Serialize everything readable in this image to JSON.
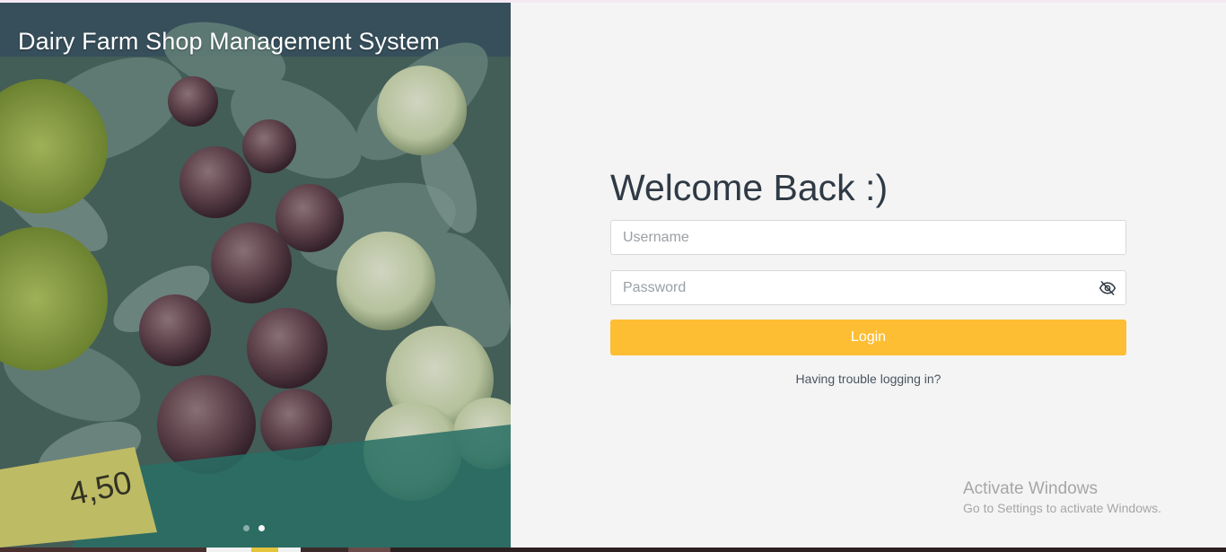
{
  "hero": {
    "title": "Dairy Farm Shop Management System",
    "image": "vegetable-market-photo",
    "carousel": {
      "count": 2,
      "active": 2
    }
  },
  "login": {
    "heading": "Welcome Back :)",
    "username": {
      "placeholder": "Username",
      "value": ""
    },
    "password": {
      "placeholder": "Password",
      "value": "",
      "toggle_icon": "eye-off-icon"
    },
    "submit_label": "Login",
    "trouble_link": "Having trouble logging in?"
  },
  "watermark": {
    "title": "Activate Windows",
    "subtitle": "Go to Settings to activate Windows."
  },
  "colors": {
    "accent": "#fdbe33",
    "background": "#f4f4f4",
    "heading": "#2f3a45"
  }
}
